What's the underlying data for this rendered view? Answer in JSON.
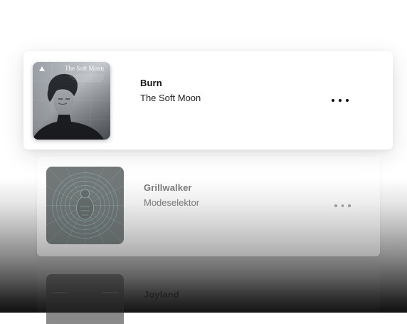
{
  "tracks": [
    {
      "title": "Burn",
      "artist": "The Soft Moon",
      "cover_text": "The Soft Moon",
      "more_icon": "more-horizontal-icon"
    },
    {
      "title": "Grillwalker",
      "artist": "Modeselektor",
      "more_icon": "more-horizontal-icon"
    },
    {
      "title": "Joyland"
    }
  ]
}
